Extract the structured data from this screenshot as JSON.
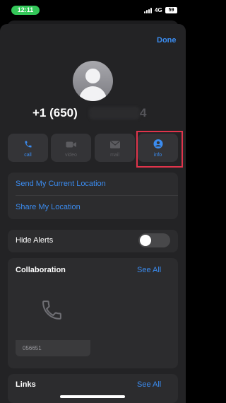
{
  "status_bar": {
    "time": "12:11",
    "network": "4G",
    "battery": "59"
  },
  "header": {
    "done_label": "Done"
  },
  "contact": {
    "number_prefix": "+1 (650)",
    "number_suffix": "4"
  },
  "actions": [
    {
      "label": "call",
      "icon": "phone-icon",
      "enabled": true
    },
    {
      "label": "video",
      "icon": "video-camera-icon",
      "enabled": false
    },
    {
      "label": "mail",
      "icon": "envelope-icon",
      "enabled": false
    },
    {
      "label": "info",
      "icon": "person-circle-icon",
      "enabled": true
    }
  ],
  "location": {
    "send_current": "Send My Current Location",
    "share": "Share My Location"
  },
  "alerts": {
    "label": "Hide Alerts",
    "enabled": false
  },
  "collaboration": {
    "title": "Collaboration",
    "see_all": "See All",
    "attachment_label": "056651"
  },
  "links": {
    "title": "Links",
    "see_all": "See All"
  },
  "colors": {
    "accent": "#3b8cf0",
    "highlight": "#e0344b",
    "status_green": "#34c759"
  }
}
